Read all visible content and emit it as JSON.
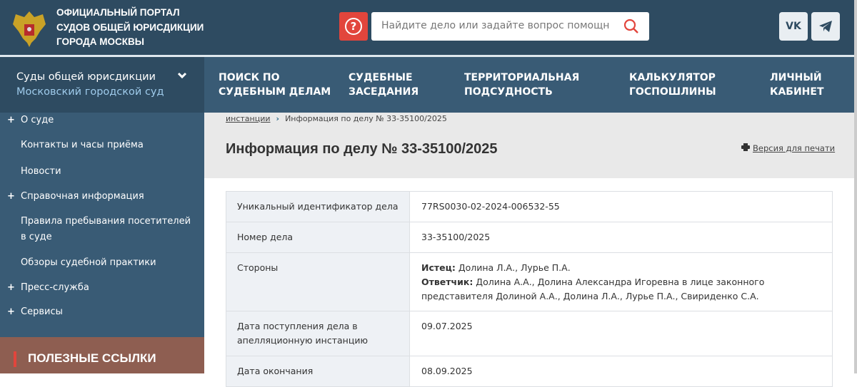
{
  "header": {
    "portal_title": [
      "ОФИЦИАЛЬНЫЙ ПОРТАЛ",
      "СУДОВ ОБЩЕЙ ЮРИСДИКЦИИ",
      "ГОРОДА МОСКВЫ"
    ],
    "search_placeholder": "Найдите дело или задайте вопрос помощнику",
    "help_icon": "?",
    "vk_label": "VK"
  },
  "court_selector": {
    "title": "Суды общей юрисдикции",
    "court": "Московский городской суд"
  },
  "nav": [
    {
      "l1": "ПОИСК ПО",
      "l2": "СУДЕБНЫМ ДЕЛАМ"
    },
    {
      "l1": "СУДЕБНЫЕ",
      "l2": "ЗАСЕДАНИЯ"
    },
    {
      "l1": "ТЕРРИТОРИАЛЬНАЯ",
      "l2": "ПОДСУДНОСТЬ"
    },
    {
      "l1": "КАЛЬКУЛЯТОР",
      "l2": "ГОСПОШЛИНЫ"
    },
    {
      "l1": "ЛИЧНЫЙ",
      "l2": "КАБИНЕТ"
    }
  ],
  "sidebar": {
    "items": [
      "О суде",
      "Контакты и часы приёма",
      "Новости",
      "Справочная информация",
      "Правила пребывания посетителей",
      "в суде",
      "Обзоры судебной практики",
      "Пресс-служба",
      "Сервисы"
    ],
    "useful_links": "ПОЛЕЗНЫЕ ССЫЛКИ"
  },
  "breadcrumb": {
    "link": "инстанции",
    "current": "Информация по делу № 33-35100/2025"
  },
  "page_title": "Информация по делу № 33-35100/2025",
  "print_label": "Версия для печати",
  "table": {
    "uid_label": "Уникальный идентификатор дела",
    "uid": "77RS0030-02-2024-006532-55",
    "num_label": "Номер дела",
    "num": "33-35100/2025",
    "parties_label": "Стороны",
    "plaintiff_label": "Истец:",
    "plaintiff": " Долина Л.А., Лурье П.А.",
    "defendant_label": "Ответчик:",
    "defendant": " Долина А.А., Долина Александра Игоревна в лице законного представителя Долиной А.А., Долина Л.А., Лурье П.А., Свириденко С.А.",
    "received_label": "Дата поступления дела в апелляционную инстанцию",
    "received": "09.07.2025",
    "end_label": "Дата окончания",
    "end": "08.09.2025"
  }
}
